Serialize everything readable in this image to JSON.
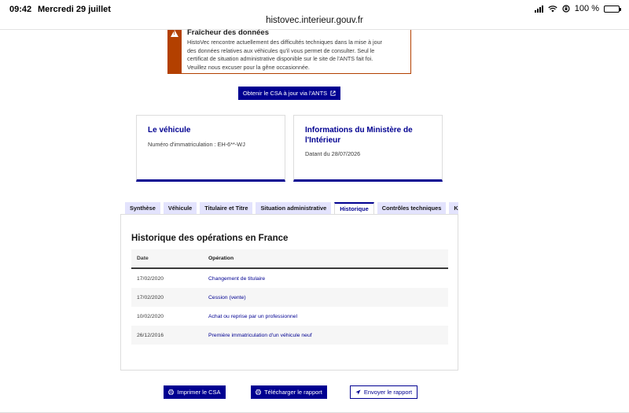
{
  "status_bar": {
    "time": "09:42",
    "date": "Mercredi 29 juillet",
    "battery": "100 %"
  },
  "browser": {
    "url": "histovec.interieur.gouv.fr"
  },
  "alert": {
    "title": "Fraîcheur des données",
    "line1": "HistoVec rencontre actuellement des difficultés techniques dans la mise à jour",
    "line2": "des données relatives aux véhicules qu'il vous permet de consulter. Seul le",
    "line3": "certificat de situation administrative disponible sur le site de l'ANTS fait foi.",
    "line4": "Veuillez nous excuser pour la gêne occasionnée.",
    "icon": "warning-icon",
    "color": "#b34000"
  },
  "csa_button": {
    "label": "Obtenir le CSA à jour via l'ANTS",
    "icon": "external-link-icon"
  },
  "vehicle_card": {
    "title": "Le véhicule",
    "subtitle": "Numéro d'immatriculation : EH-6**-WJ"
  },
  "ministry_card": {
    "title_line1": "Informations du Ministère de",
    "title_line2": "l'Intérieur",
    "subtitle": "Datant du 28/07/2026"
  },
  "tabs": [
    {
      "label": "Synthèse",
      "active": false
    },
    {
      "label": "Véhicule",
      "active": false
    },
    {
      "label": "Titulaire et Titre",
      "active": false
    },
    {
      "label": "Situation administrative",
      "active": false
    },
    {
      "label": "Historique",
      "active": true
    },
    {
      "label": "Contrôles techniques",
      "active": false
    },
    {
      "label": "Kilométrage",
      "active": false
    }
  ],
  "history": {
    "title": "Historique des opérations en France",
    "columns": {
      "date": "Date",
      "operation": "Opération"
    },
    "rows": [
      {
        "date": "17/02/2020",
        "operation": "Changement de titulaire"
      },
      {
        "date": "17/02/2020",
        "operation": "Cession (vente)"
      },
      {
        "date": "10/02/2020",
        "operation": "Achat ou reprise par un professionnel"
      },
      {
        "date": "26/12/2016",
        "operation": "Première immatriculation d'un véhicule neuf"
      }
    ]
  },
  "actions": {
    "print": {
      "label": "Imprimer le CSA",
      "icon": "printer-icon"
    },
    "download": {
      "label": "Télécharger le rapport",
      "icon": "printer-icon"
    },
    "send": {
      "label": "Envoyer le rapport",
      "icon": "send-icon"
    }
  },
  "colors": {
    "primary": "#000091",
    "warning": "#b34000",
    "tab_bg": "#e3e3fd"
  }
}
